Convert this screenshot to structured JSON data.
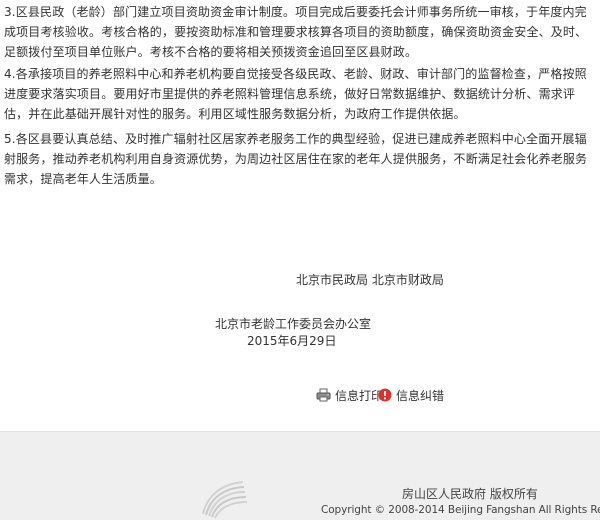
{
  "article": {
    "paragraphs": [
      "3.区县民政（老龄）部门建立项目资助资金审计制度。项目完成后要委托会计师事务所统一审核，于年度内完成项目考核验收。考核合格的，要按资助标准和管理要求核算各项目的资助额度，确保资助资金安全、及时、足额拨付至项目单位账户。考核不合格的要将相关预拨资金追回至区县财政。",
      "4.各承接项目的养老照料中心和养老机构要自觉接受各级民政、老龄、财政、审计部门的监督检查，严格按照进度要求落实项目。要用好市里提供的养老照料管理信息系统，做好日常数据维护、数据统计分析、需求评估，并在此基础开展针对性的服务。利用区域性服务数据分析，为政府工作提供依据。",
      "5.各区县要认真总结、及时推广辐射社区居家养老服务工作的典型经验，促进已建成养老照料中心全面开展辐射服务，推动养老机构利用自身资源优势，为周边社区居住在家的老年人提供服务，不断满足社会化养老服务需求，提高老年人生活质量。"
    ],
    "signature": {
      "bureaus": "北京市民政局 北京市财政局",
      "office": "北京市老龄工作委员会办公室",
      "date": "2015年6月29日"
    }
  },
  "actions": {
    "print_label": "信息打印",
    "error_label": "信息纠错"
  },
  "footer": {
    "owner": "房山区人民政府 版权所有",
    "copyright": "Copyright © 2008-2014 Beijing Fangshan All Rights Reserved."
  },
  "colors": {
    "text": "#333333",
    "footer_bg": "#efefef",
    "error_icon": "#d9342b"
  },
  "icons": {
    "print": "printer-icon",
    "error": "error-report-icon"
  }
}
